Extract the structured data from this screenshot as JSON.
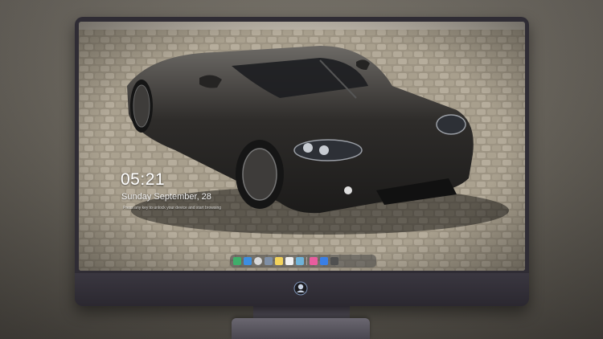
{
  "lockscreen": {
    "time": "05:21",
    "date": "Sunday September, 28",
    "notice": "Press any key to unlock your device and start browsing"
  },
  "wallpaper": {
    "subject": "dark sports car on cobblestone",
    "colors": {
      "car_body": "#2b2a28",
      "cobblestone": "#a39a8b",
      "wheel": "#3e3c3a"
    }
  },
  "dock": {
    "items": [
      {
        "icon": "finder-icon",
        "color": "#3fae6a"
      },
      {
        "icon": "messages-icon",
        "color": "#3d8ee0"
      },
      {
        "icon": "safari-icon",
        "color": "#d8d8d8"
      },
      {
        "icon": "launchpad-icon",
        "color": "#7f8fa5"
      },
      {
        "icon": "notes-icon",
        "color": "#f3d35c"
      },
      {
        "icon": "calendar-icon",
        "color": "#f1f1f1"
      },
      {
        "icon": "photos-icon",
        "color": "#6fb3d9"
      },
      {
        "icon": "music-icon",
        "color": "#e85d9e"
      },
      {
        "icon": "appstore-icon",
        "color": "#3a7fe5"
      },
      {
        "icon": "camera-icon",
        "color": "#505050"
      }
    ]
  }
}
